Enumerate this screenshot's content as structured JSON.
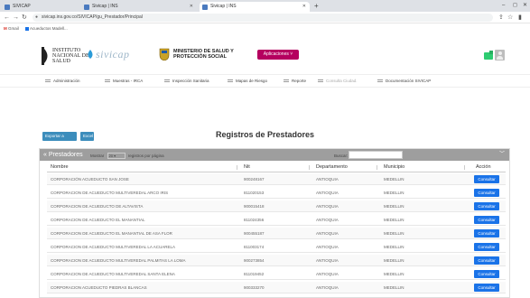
{
  "browser": {
    "tabs": [
      {
        "label": "SIVICAP",
        "color": "#4a7abf",
        "active": false
      },
      {
        "label": "Sivicap | INS",
        "color": "#4a7abf",
        "active": false
      },
      {
        "label": "Sivicap | INS",
        "color": "#4a7abf",
        "active": true
      }
    ],
    "url": "sivicap.ins.gov.co/SIVICAP/gu_Prestador/Principal",
    "bookmarks": [
      {
        "label": "Gmail",
        "color": "#d93025"
      },
      {
        "label": "Acueductos Madell...",
        "color": "#1a73e8"
      }
    ]
  },
  "header": {
    "ins_name": [
      "INSTITUTO",
      "NACIONAL DE",
      "SALUD"
    ],
    "sivicap": "sivicap",
    "ministry": [
      "MINISTERIO DE SALUD Y",
      "PROTECCIÓN SOCIAL"
    ],
    "apps_button": "Aplicaciones ˅",
    "accent": "#b5005f"
  },
  "nav": [
    {
      "label": "Administración"
    },
    {
      "label": "Muestras - IRCA"
    },
    {
      "label": "Inspección Sanitaria"
    },
    {
      "label": "Mapas de Riesgo"
    },
    {
      "label": "Reporte"
    },
    {
      "label": "Consulta Ciudad."
    },
    {
      "label": "Documentación SIVICAP"
    }
  ],
  "actions": {
    "export_excel": "Exportar a Excel",
    "other": "Excel"
  },
  "page_title": "Registros de Prestadores",
  "panel": {
    "title": "Prestadores",
    "length_prefix": "Mostrar",
    "length_value": "20",
    "length_suffix": "registros por página",
    "search_label": "Buscar:",
    "search_value": ""
  },
  "table": {
    "columns": [
      "Nombre",
      "Nit",
      "Departamento",
      "Municipio",
      "Acción"
    ],
    "rows": [
      {
        "nombre": "CORPORACIÓN ACUEDUCTO SAN JOSE",
        "nit": "900248167",
        "depto": "ANTIOQUIA",
        "mpio": "MEDELLIN",
        "accion": "Consultar"
      },
      {
        "nombre": "CORPORACION DE ACUEDUCTO MULTIVEREDAL ARCO IRIS",
        "nit": "811020153",
        "depto": "ANTIOQUIA",
        "mpio": "MEDELLIN",
        "accion": "Consultar"
      },
      {
        "nombre": "CORPORACION DE ACUEDUCTO DE ALTAVISTA",
        "nit": "900015418",
        "depto": "ANTIOQUIA",
        "mpio": "MEDELLIN",
        "accion": "Consultar"
      },
      {
        "nombre": "CORPORACION DE ACUEDUCTO EL MANANTIAL",
        "nit": "811024356",
        "depto": "ANTIOQUIA",
        "mpio": "MEDELLIN",
        "accion": "Consultar"
      },
      {
        "nombre": "CORPORACION DE ACUEDUCTO EL MANANTIAL DE ASA FLOR",
        "nit": "900455187",
        "depto": "ANTIOQUIA",
        "mpio": "MEDELLIN",
        "accion": "Consultar"
      },
      {
        "nombre": "CORPORACION DE ACUEDUCTO MULTIVEREDAL LA ACUARELA",
        "nit": "811003174",
        "depto": "ANTIOQUIA",
        "mpio": "MEDELLIN",
        "accion": "Consultar"
      },
      {
        "nombre": "CORPORACION DE ACUEDUCTO MULTIVEREDAL PALMITAS LA LOMA",
        "nit": "900273854",
        "depto": "ANTIOQUIA",
        "mpio": "MEDELLIN",
        "accion": "Consultar"
      },
      {
        "nombre": "CORPORACION DE ACUEDUCTO MULTIVEREDAL SANTA ELENA",
        "nit": "811019452",
        "depto": "ANTIOQUIA",
        "mpio": "MEDELLIN",
        "accion": "Consultar"
      },
      {
        "nombre": "CORPORACION ACUEDUCTO PIEDRAS BLANCAS",
        "nit": "900333270",
        "depto": "ANTIOQUIA",
        "mpio": "MEDELLIN",
        "accion": "Consultar"
      }
    ]
  }
}
